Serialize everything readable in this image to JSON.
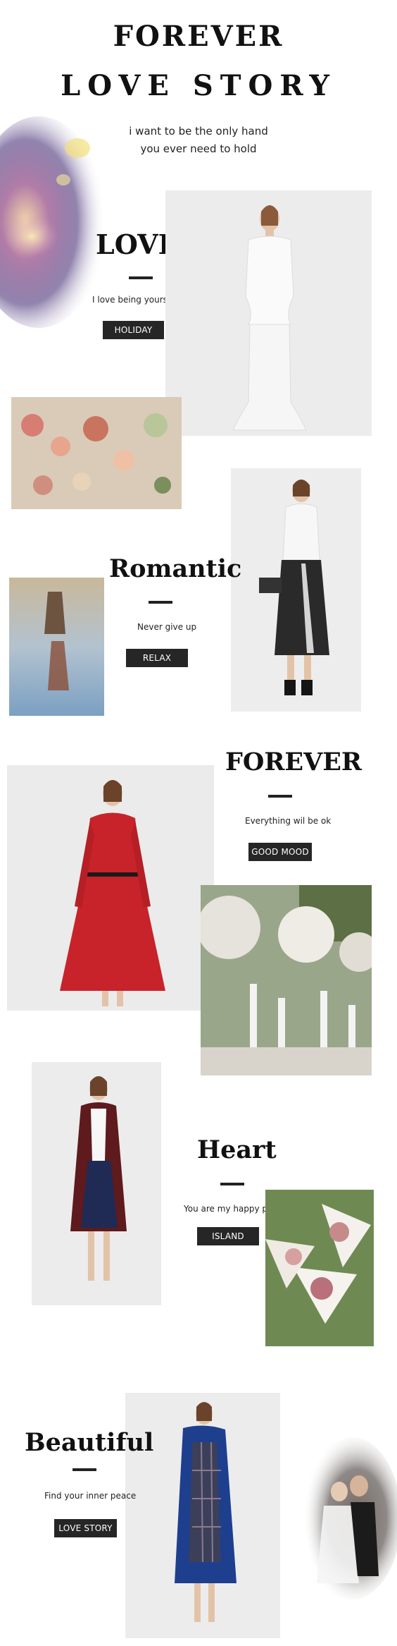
{
  "header": {
    "title_line1": "FOREVER",
    "title_line2": "LOVE STORY",
    "subtitle_line1": "i want to be the only hand",
    "subtitle_line2": "you ever need to hold"
  },
  "sections": [
    {
      "heading": "LOVE",
      "caption": "I love being yours",
      "button": "HOLIDAY"
    },
    {
      "heading": "Romantic",
      "caption": "Never give up",
      "button": "RELAX"
    },
    {
      "heading": "FOREVER",
      "caption": "Everything wil be ok",
      "button": "GOOD MOOD"
    },
    {
      "heading": "Heart",
      "caption": "You are my happy place",
      "button": "ISLAND"
    },
    {
      "heading": "Beautiful",
      "caption": "Find your inner peace",
      "button": "LOVE STORY"
    }
  ],
  "colors": {
    "heading": "#111111",
    "button_bg": "#262626",
    "button_text": "#ffffff",
    "red_dress": "#c8232a",
    "burgundy_coat": "#5e1a1d",
    "blue_coat": "#1e3f8e"
  }
}
